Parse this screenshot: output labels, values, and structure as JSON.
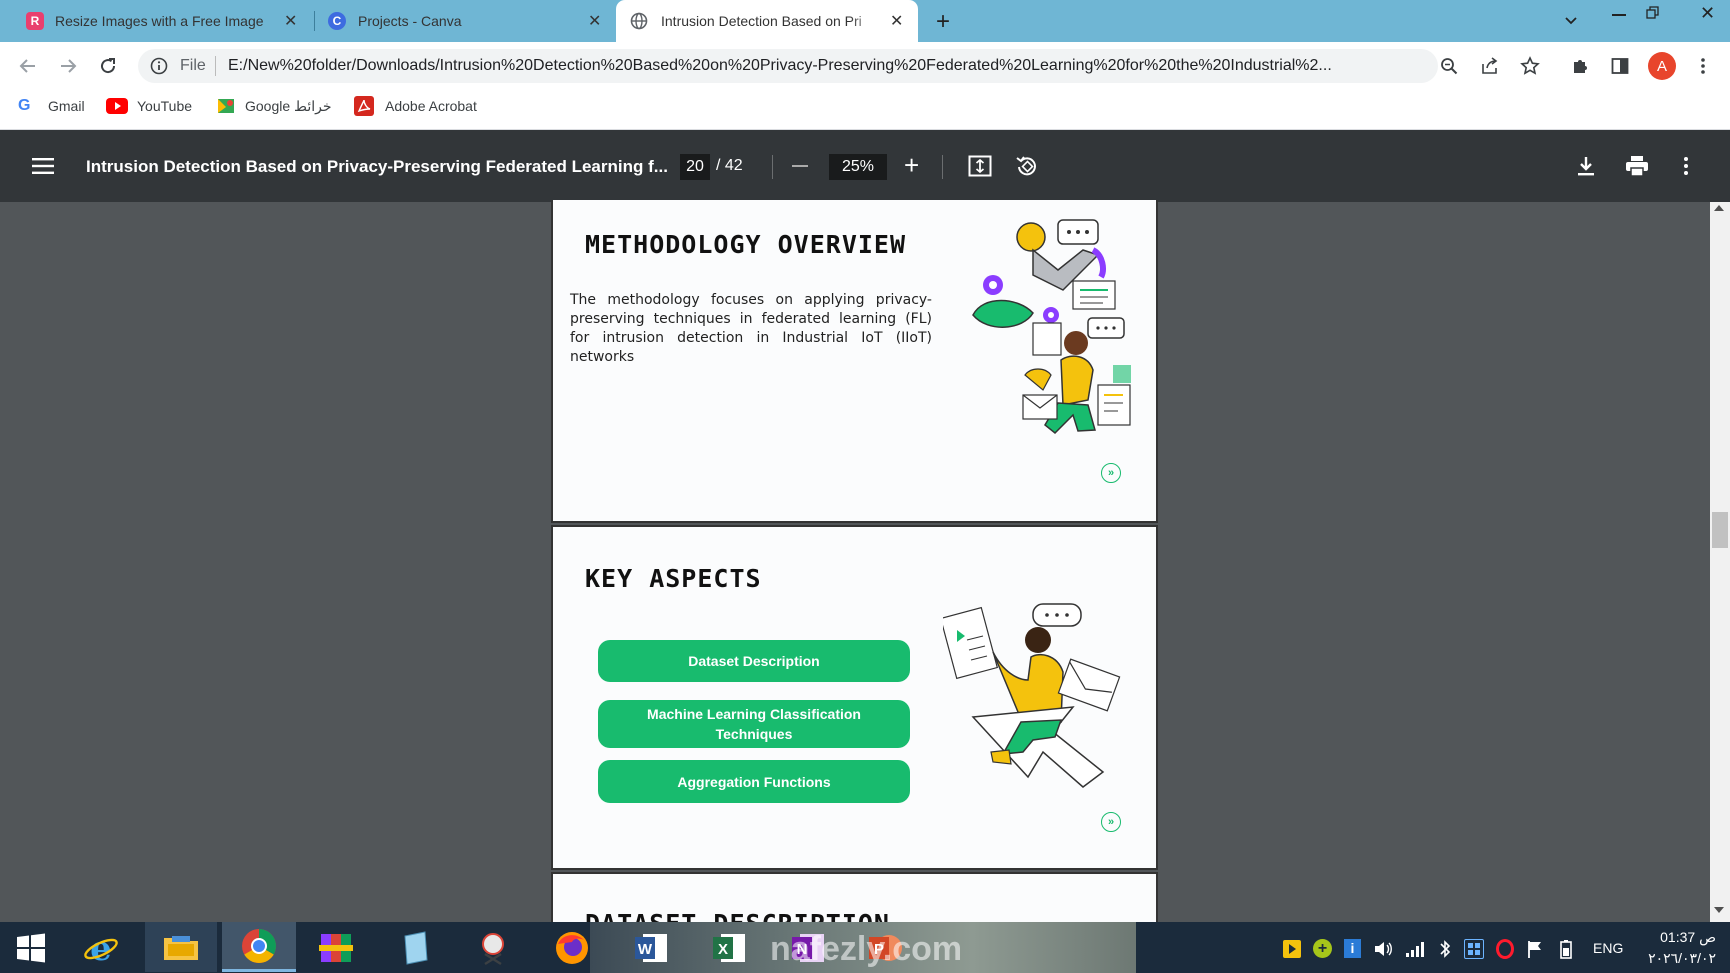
{
  "tabs": [
    {
      "title": "Resize Images with a Free Image",
      "favicon": "R",
      "color": "#8b3dff"
    },
    {
      "title": "Projects - Canva",
      "favicon": "C",
      "color": "#2b5fd9"
    },
    {
      "title": "Intrusion Detection Based on Pri",
      "favicon": "globe-icon",
      "color": "#5f6368"
    }
  ],
  "address": {
    "scheme": "File",
    "url": "E:/New%20folder/Downloads/Intrusion%20Detection%20Based%20on%20Privacy-Preserving%20Federated%20Learning%20for%20the%20Industrial%2..."
  },
  "profile_initial": "A",
  "bookmarks": [
    {
      "label": "Gmail"
    },
    {
      "label": "YouTube"
    },
    {
      "label": "Google خرائط"
    },
    {
      "label": "Adobe Acrobat"
    }
  ],
  "pdf": {
    "title": "Intrusion Detection Based on Privacy-Preserving Federated Learning f...",
    "page_current": "20",
    "page_total": "/ 42",
    "zoom": "25%"
  },
  "slides": {
    "methodology": {
      "title": "METHODOLOGY OVERVIEW",
      "body": "The methodology focuses on applying privacy-preserving techniques in federated learning (FL) for intrusion detection in Industrial IoT (IIoT) networks"
    },
    "key_aspects": {
      "title": "KEY ASPECTS",
      "buttons": [
        "Dataset Description",
        "Machine Learning Classification Techniques",
        "Aggregation Functions"
      ]
    },
    "next_partial_title": "DATASET DESCRIPTION"
  },
  "watermark": "nafezly.com",
  "taskbar": {
    "lang": "ENG",
    "time": "01:37 ص",
    "date": "٢٠٢٦/٠٣/٠٢"
  },
  "colors": {
    "accent_green": "#18bb6e",
    "tab_strip": "#6fb6d4",
    "pdf_bar": "#323639",
    "viewer_bg": "#525659"
  }
}
